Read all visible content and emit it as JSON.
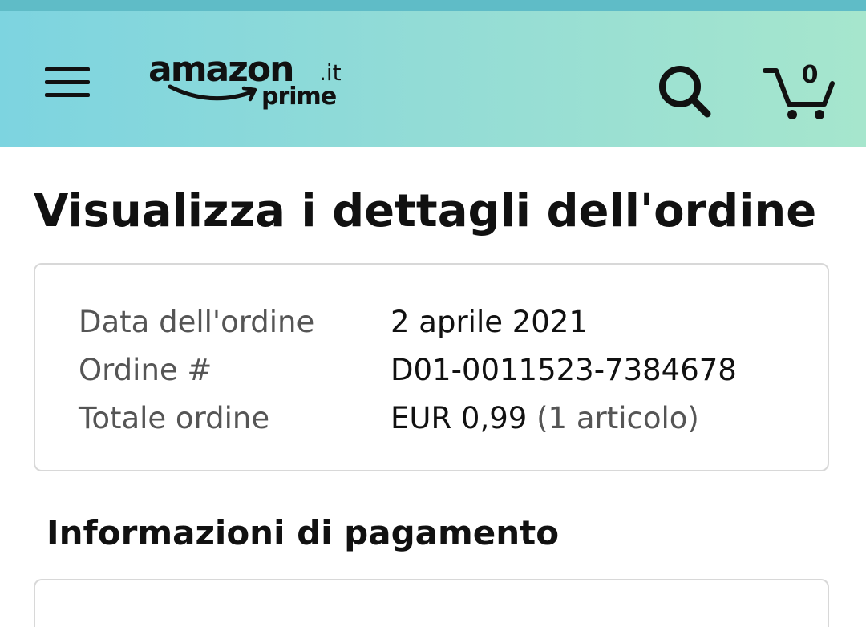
{
  "header": {
    "logo": {
      "brand": "amazon",
      "tld": ".it",
      "sub": "prime"
    },
    "menu_icon": "hamburger-menu-icon",
    "search_icon": "search-icon",
    "cart_icon": "shopping-cart-icon",
    "cart_count": "0"
  },
  "page": {
    "title": "Visualizza i dettagli dell'ordine"
  },
  "order_summary": {
    "rows": [
      {
        "label": "Data dell'ordine",
        "value": "2 aprile 2021",
        "note": ""
      },
      {
        "label": "Ordine #",
        "value": "D01-0011523-7384678",
        "note": ""
      },
      {
        "label": "Totale ordine",
        "value": "EUR 0,99",
        "note": "(1 articolo)"
      }
    ]
  },
  "payment": {
    "title": "Informazioni di pagamento"
  },
  "colors": {
    "header_gradient_start": "#7dd4e0",
    "header_gradient_end": "#a6e6cd",
    "top_strip": "#5fbcc7",
    "text_primary": "#111111",
    "text_secondary": "#555555",
    "card_border": "#d8d8d8"
  }
}
